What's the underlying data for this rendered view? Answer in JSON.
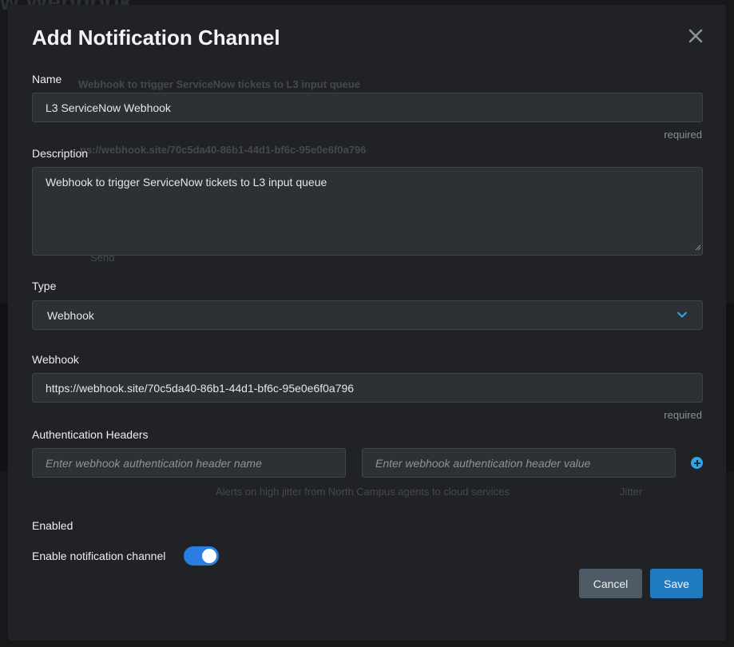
{
  "background": {
    "page_title": "w Webhook",
    "ghost_description": "Webhook to trigger ServiceNow tickets to L3 input queue",
    "ghost_url": "ps://webhook.site/70c5da40-86b1-44d1-bf6c-95e0e6f0a796",
    "ghost_send": "Send",
    "ghost_row_text": "Alerts on high jitter from North Campus agents to cloud services",
    "ghost_row_type": "Jitter"
  },
  "modal": {
    "title": "Add Notification Channel",
    "close_icon": "close-icon",
    "name": {
      "label": "Name",
      "value": "L3 ServiceNow Webhook",
      "hint": "required"
    },
    "description": {
      "label": "Description",
      "value": "Webhook to trigger ServiceNow tickets to L3 input queue"
    },
    "type": {
      "label": "Type",
      "selected": "Webhook",
      "icon": "chevron-down-icon"
    },
    "webhook": {
      "label": "Webhook",
      "value": "https://webhook.site/70c5da40-86b1-44d1-bf6c-95e0e6f0a796",
      "hint": "required"
    },
    "auth_headers": {
      "label": "Authentication Headers",
      "name_placeholder": "Enter webhook authentication header name",
      "value_placeholder": "Enter webhook authentication header value",
      "add_icon": "plus-circle-icon"
    },
    "enabled": {
      "label": "Enabled",
      "toggle_label": "Enable notification channel",
      "on": true
    },
    "buttons": {
      "cancel": "Cancel",
      "save": "Save"
    }
  },
  "colors": {
    "accent": "#1f7ac0",
    "toggle": "#2a7de1",
    "add_icon": "#2ea7e6",
    "chevron": "#2ea7e6"
  }
}
